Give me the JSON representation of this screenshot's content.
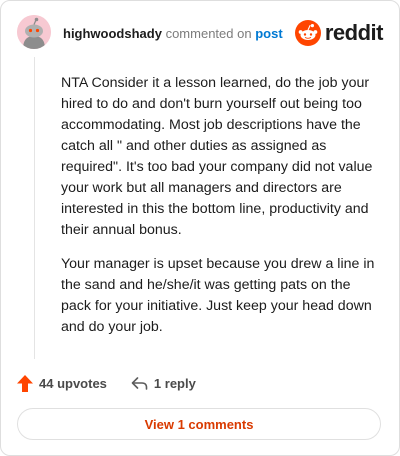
{
  "comment": {
    "username": "highwoodshady",
    "action_text": "commented on",
    "target_link": "post",
    "paragraphs": [
      "NTA Consider it a lesson learned, do the job your hired to do and don't burn yourself out being too accommodating. Most job descriptions have the catch all \" and other duties as assigned as required\". It's too bad your company did not value your work but all managers and directors are interested in this the bottom line, productivity and their annual bonus.",
      "Your manager is upset because you drew a line in the sand and he/she/it was getting pats on the pack for your initiative. Just keep your head down and do your job."
    ]
  },
  "brand": {
    "wordmark": "reddit",
    "icon": "reddit-snoo-icon",
    "color": "#ff4500"
  },
  "avatar": {
    "icon": "snoo-avatar-icon",
    "background": "#f7c9d2"
  },
  "actions": {
    "upvotes_label": "44 upvotes",
    "upvote_icon": "upvote-arrow-icon",
    "upvote_color": "#ff4500",
    "reply_label": "1 reply",
    "reply_icon": "reply-arrow-icon"
  },
  "footer": {
    "view_comments_label": "View 1 comments",
    "accent": "#d93a00"
  }
}
